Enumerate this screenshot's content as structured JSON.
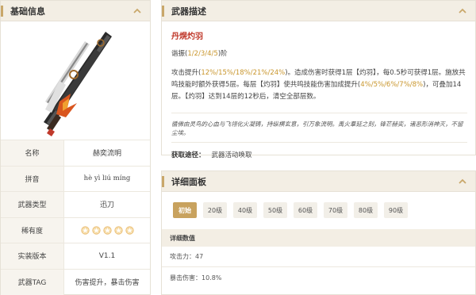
{
  "basic_info": {
    "title": "基础信息",
    "rows": [
      {
        "label": "名称",
        "value": "赫奕流明"
      },
      {
        "label": "拼音",
        "value": "hè yì liú míng"
      },
      {
        "label": "武器类型",
        "value": "迅刀"
      },
      {
        "label": "稀有度",
        "stars": 5
      },
      {
        "label": "实装版本",
        "value": "V1.1"
      },
      {
        "label": "武器TAG",
        "value": "伤害提升，暴击伤害"
      }
    ]
  },
  "weapon_desc": {
    "title": "武器描述",
    "skill_name": "丹熀灼羽",
    "refine_prefix": "谐振(",
    "refine_levels": "1/2/3/4/5",
    "refine_suffix": ")阶",
    "effect_parts": [
      {
        "text": "攻击提升(",
        "hl": false
      },
      {
        "text": "12%/15%/18%/21%/24%",
        "hl": true
      },
      {
        "text": ")。造成伤害时获得1层【灼羽】，每0.5秒可获得1层。施放共鸣技能时额外获得5层。每层【灼羽】使共鸣技能伤害加成提升(",
        "hl": false
      },
      {
        "text": "4%/5%/6%/7%/8%",
        "hl": true
      },
      {
        "text": ")，可叠加14层。【灼羽】达到14层的12秒后，清空全部层数。",
        "hl": false
      }
    ],
    "lore": "循佛由灵鸟的心血与飞翎化火凝铸，持纵横玄意，引万象流明。禹火羣延之刻，锋芒赫奕，诸恶形消神灭，不留尘埃。",
    "source_label": "获取途径：",
    "source_value": "武器活动唤取"
  },
  "detail_panel": {
    "title": "详细面板",
    "tabs": [
      "初始",
      "20级",
      "40级",
      "50级",
      "60级",
      "70级",
      "80级",
      "90级"
    ],
    "active_tab": 0,
    "stats_header": "详细数值",
    "stats": [
      {
        "text": "攻击力：47"
      },
      {
        "text": "暴击伤害：10.8%"
      }
    ]
  },
  "colors": {
    "accent_gold": "#c8a25e",
    "skill_red": "#c0392b",
    "highlight": "#c9962d",
    "header_bg": "#f3eee4"
  }
}
